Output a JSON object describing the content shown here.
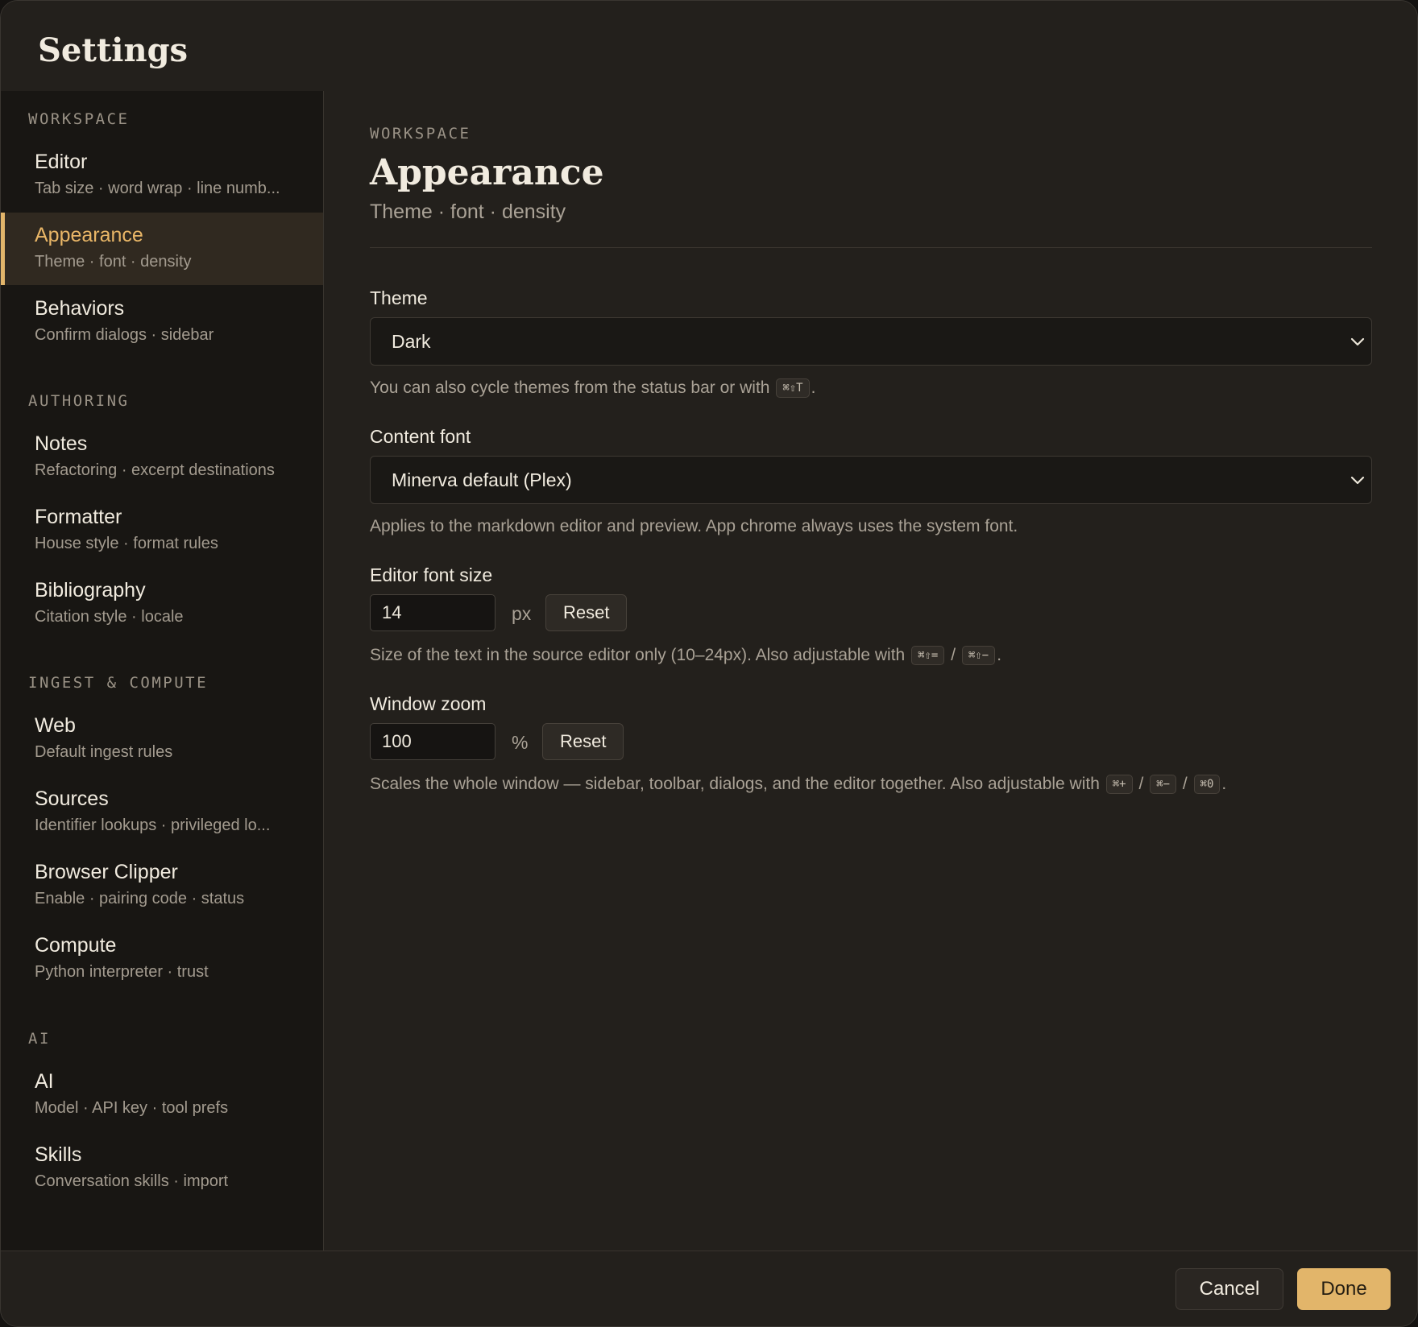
{
  "dialog": {
    "title": "Settings"
  },
  "sidebar": {
    "sections": [
      {
        "heading": "WORKSPACE",
        "items": [
          {
            "title": "Editor",
            "subtitle": "Tab size · word wrap · line numb..."
          },
          {
            "title": "Appearance",
            "subtitle": "Theme · font · density",
            "active": true
          },
          {
            "title": "Behaviors",
            "subtitle": "Confirm dialogs · sidebar"
          }
        ]
      },
      {
        "heading": "AUTHORING",
        "items": [
          {
            "title": "Notes",
            "subtitle": "Refactoring · excerpt destinations"
          },
          {
            "title": "Formatter",
            "subtitle": "House style · format rules"
          },
          {
            "title": "Bibliography",
            "subtitle": "Citation style · locale"
          }
        ]
      },
      {
        "heading": "INGEST & COMPUTE",
        "items": [
          {
            "title": "Web",
            "subtitle": "Default ingest rules"
          },
          {
            "title": "Sources",
            "subtitle": "Identifier lookups · privileged lo..."
          },
          {
            "title": "Browser Clipper",
            "subtitle": "Enable · pairing code · status"
          },
          {
            "title": "Compute",
            "subtitle": "Python interpreter · trust"
          }
        ]
      },
      {
        "heading": "AI",
        "items": [
          {
            "title": "AI",
            "subtitle": "Model · API key · tool prefs"
          },
          {
            "title": "Skills",
            "subtitle": "Conversation skills · import"
          }
        ]
      }
    ]
  },
  "content": {
    "eyebrow": "WORKSPACE",
    "title": "Appearance",
    "subtitle": "Theme · font · density",
    "theme": {
      "label": "Theme",
      "value": "Dark",
      "help_text": "You can also cycle themes from the status bar or with",
      "shortcut": "⌘⇧T",
      "help_end": "."
    },
    "content_font": {
      "label": "Content font",
      "value": "Minerva default (Plex)",
      "help_text": "Applies to the markdown editor and preview. App chrome always uses the system font."
    },
    "editor_font_size": {
      "label": "Editor font size",
      "value": "14",
      "unit": "px",
      "reset_label": "Reset",
      "help_text": "Size of the text in the source editor only (10–24px). Also adjustable with",
      "shortcut_a": "⌘⇧=",
      "separator": "/",
      "shortcut_b": "⌘⇧−",
      "help_end": "."
    },
    "window_zoom": {
      "label": "Window zoom",
      "value": "100",
      "unit": "%",
      "reset_label": "Reset",
      "help_text": "Scales the whole window — sidebar, toolbar, dialogs, and the editor together. Also adjustable with",
      "shortcut_a": "⌘+",
      "separator": "/",
      "shortcut_b": "⌘−",
      "shortcut_c": "⌘0",
      "help_end": "."
    }
  },
  "footer": {
    "cancel_label": "Cancel",
    "done_label": "Done"
  },
  "colors": {
    "accent": "#e2b56a",
    "background": "#23201c",
    "sidebar": "#181613"
  }
}
